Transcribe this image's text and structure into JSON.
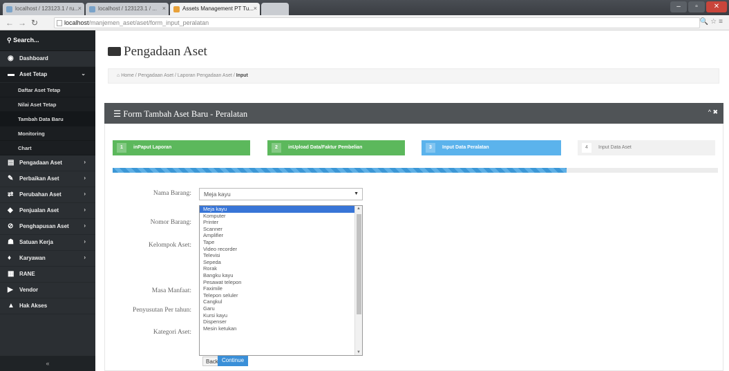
{
  "browser": {
    "tabs": [
      "localhost / 123123.1 / ru...",
      "localhost / 123123.1 / ...",
      "Assets Management PT Tu...",
      ""
    ],
    "url_host": "localhost",
    "url_path": "/manjemen_aset/aset/form_input_peralatan"
  },
  "sidebar": {
    "search": "Search...",
    "items": [
      {
        "label": "Dashboard",
        "icon": "dashboard-icon",
        "glyph": "◉"
      },
      {
        "label": "Aset Tetap",
        "icon": "briefcase-icon",
        "glyph": "▬"
      },
      {
        "label": "Pengadaan Aset",
        "icon": "table-icon",
        "glyph": "▤"
      },
      {
        "label": "Perbaikan Aset",
        "icon": "wrench-icon",
        "glyph": "✎"
      },
      {
        "label": "Perubahan Aset",
        "icon": "exchange-icon",
        "glyph": "⇄"
      },
      {
        "label": "Penjualan Aset",
        "icon": "tag-icon",
        "glyph": "◆"
      },
      {
        "label": "Penghapusan Aset",
        "icon": "ban-icon",
        "glyph": "⊘"
      },
      {
        "label": "Satuan Kerja",
        "icon": "users-icon",
        "glyph": "☗"
      },
      {
        "label": "Karyawan",
        "icon": "user-icon",
        "glyph": "♦"
      },
      {
        "label": "RANE",
        "icon": "list-icon",
        "glyph": "▦"
      },
      {
        "label": "Vendor",
        "icon": "truck-icon",
        "glyph": "▶"
      },
      {
        "label": "Hak Akses",
        "icon": "user-lock-icon",
        "glyph": "▲"
      }
    ],
    "sub_items": [
      "Daftar Aset Tetap",
      "Nilai Aset Tetap",
      "Tambah Data Baru",
      "Monitoring",
      "Chart"
    ]
  },
  "page": {
    "title": "Pengadaan Aset",
    "breadcrumb_prefix": "Home / Pengadaan Aset / Laporan Pengadaan Aset / ",
    "breadcrumb_current": "Input"
  },
  "panel": {
    "title": "Form Tambah Aset Baru - Peralatan",
    "controls": "^ ✖"
  },
  "steps": [
    {
      "num": "1",
      "label": "inPaput Laporan"
    },
    {
      "num": "2",
      "label": "inUpload Data/Faktur Pembelian"
    },
    {
      "num": "3",
      "label": "Input Data Peralatan"
    },
    {
      "num": "4",
      "label": "Input Data Aset"
    }
  ],
  "progress": {
    "percent": 75
  },
  "form": {
    "labels": [
      "Nama Barang:",
      "Nomor Barang:",
      "Kelompok Aset:",
      "Masa Manfaat:",
      "Penyusutan Per tahun:",
      "Kategori Aset:"
    ],
    "select_value": "Meja kayu",
    "options": [
      "Meja kayu",
      "Komputer",
      "Printer",
      "Scanner",
      "Amplifier",
      "Tape",
      "Video recorder",
      "Televisi",
      "Sepeda",
      "Rorak",
      "Bangku kayu",
      "Pesawat telepon",
      "Faximile",
      "Telepon seluler",
      "Cangkul",
      "Garu",
      "Kursi kayu",
      "Dispenser",
      "Mesin ketukan"
    ],
    "back_label": "Back",
    "continue_label": "Continue"
  }
}
